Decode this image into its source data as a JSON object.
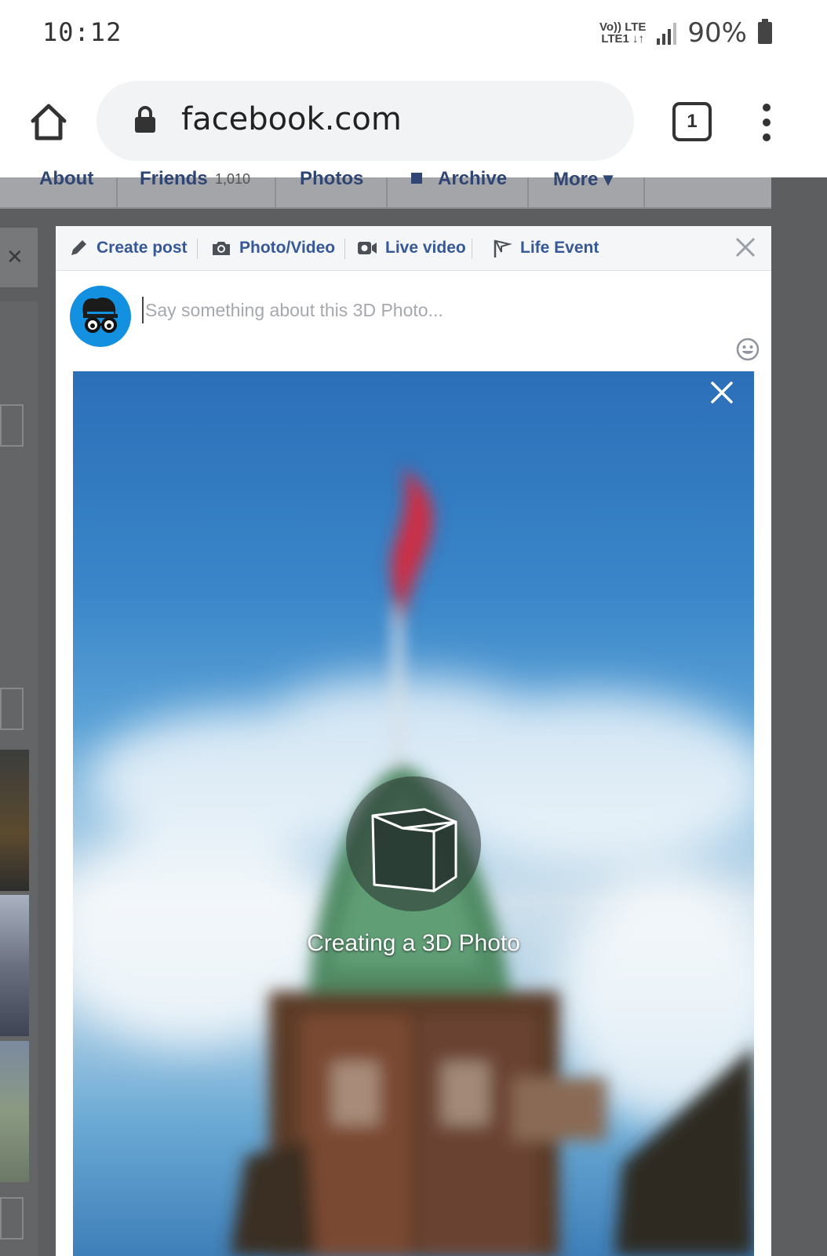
{
  "status_bar": {
    "time": "10:12",
    "volte_top": "Vo)) LTE",
    "volte_bottom": "LTE1 ↓↑",
    "battery": "90%"
  },
  "browser": {
    "url": "facebook.com",
    "tab_count": "1",
    "icons": [
      "home-icon",
      "lock-icon",
      "tabs-icon",
      "more-vert-icon"
    ]
  },
  "background_page": {
    "nav_items": [
      "About",
      "Friends",
      "1,010",
      "Photos",
      "Archive",
      "More ▾"
    ]
  },
  "composer": {
    "tabs": [
      {
        "label": "Create post",
        "icon": "pencil-icon"
      },
      {
        "label": "Photo/Video",
        "icon": "camera-icon"
      },
      {
        "label": "Live video",
        "icon": "video-camera-icon"
      },
      {
        "label": "Life Event",
        "icon": "flag-icon"
      }
    ],
    "placeholder": "Say something about this 3D Photo...",
    "processing_text": "Creating a 3D Photo"
  },
  "colors": {
    "fb_blue": "#365899",
    "avatar_bg": "#1391e0",
    "overlay": "#5d5e60"
  }
}
